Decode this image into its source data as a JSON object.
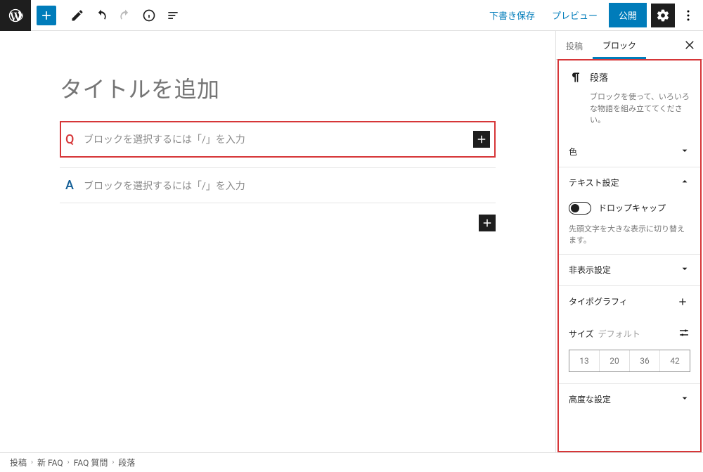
{
  "toolbar": {
    "save_draft": "下書き保存",
    "preview": "プレビュー",
    "publish": "公開"
  },
  "editor": {
    "title_placeholder": "タイトルを追加",
    "block_placeholder": "ブロックを選択するには「/」を入力",
    "q_letter": "Q",
    "a_letter": "A"
  },
  "sidebar": {
    "tab_post": "投稿",
    "tab_block": "ブロック",
    "block_info": {
      "title": "段落",
      "desc": "ブロックを使って、いろいろな物語を組み立ててください。"
    },
    "panels": {
      "color": "色",
      "text_settings": "テキスト設定",
      "dropcap_label": "ドロップキャップ",
      "dropcap_help": "先頭文字を大きな表示に切り替えます。",
      "hidden": "非表示設定",
      "typography": "タイポグラフィ",
      "size_label": "サイズ",
      "size_default": "デフォルト",
      "size_opts": [
        "13",
        "20",
        "36",
        "42"
      ],
      "advanced": "高度な設定"
    }
  },
  "breadcrumbs": [
    "投稿",
    "新 FAQ",
    "FAQ 質問",
    "段落"
  ]
}
